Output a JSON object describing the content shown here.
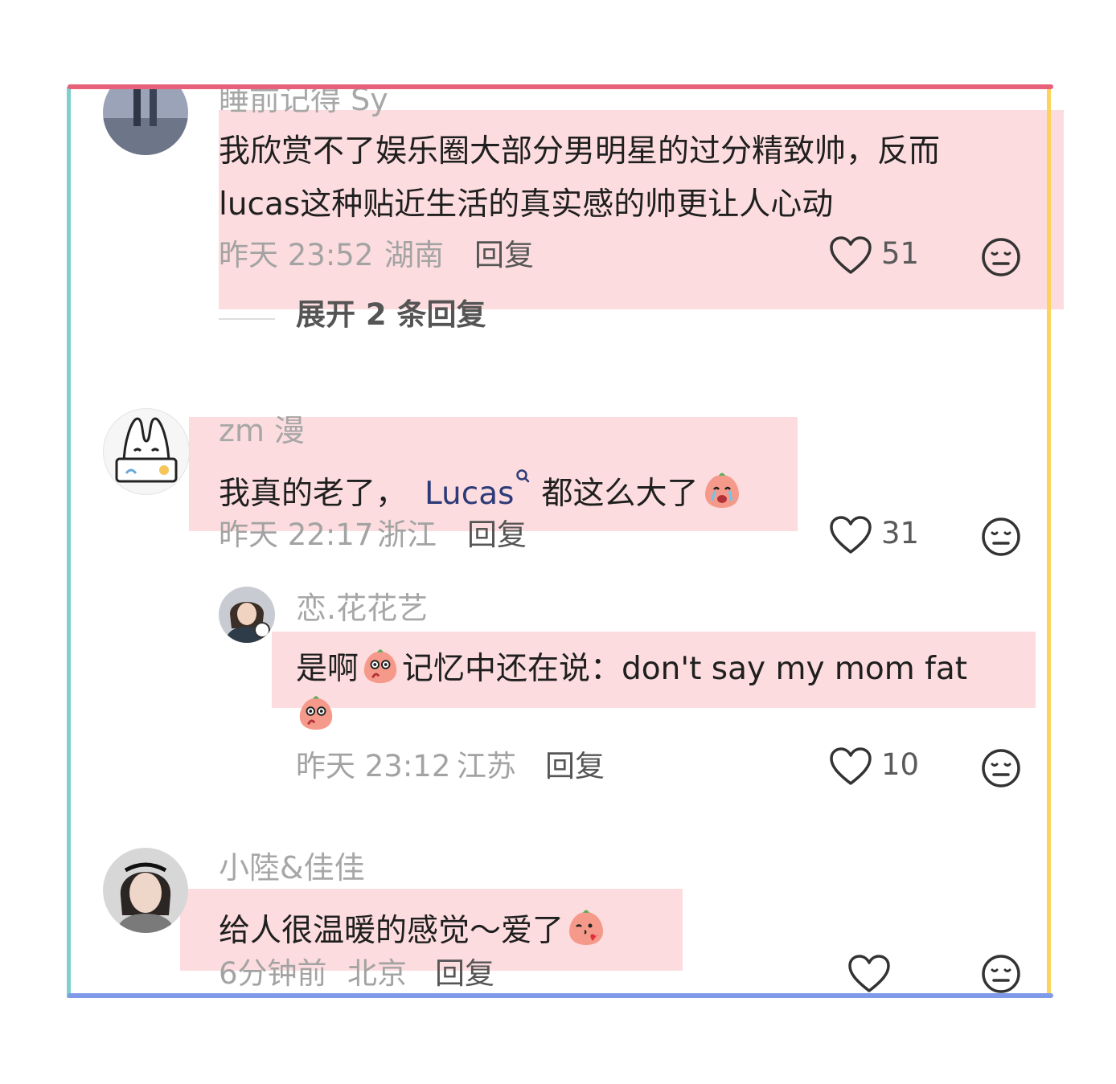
{
  "comments": [
    {
      "username": "睡前记得 Sy",
      "text_line1": "我欣赏不了娱乐圈大部分男明星的过分精致帅，反而",
      "text_line2": "lucas这种贴近生活的真实感的帅更让人心动",
      "time": "昨天 23:52",
      "location": "湖南",
      "reply_label": "回复",
      "likes": "51",
      "expand_label": "展开 2 条回复"
    },
    {
      "username": "zm 漫",
      "text_prefix": "我真的老了，",
      "link_text": "Lucas",
      "text_suffix": "都这么大了",
      "time": "昨天 22:17",
      "location": "浙江",
      "reply_label": "回复",
      "likes": "31",
      "reply": {
        "username": "恋.花花艺",
        "text_prefix": "是啊",
        "text_suffix": "记忆中还在说：don't  say  my mom fat",
        "time": "昨天 23:12",
        "location": "江苏",
        "reply_label": "回复",
        "likes": "10"
      }
    },
    {
      "username": "小陸&佳佳",
      "text": "给人很温暖的感觉～爱了",
      "time": "6分钟前",
      "location": "北京",
      "reply_label": "回复",
      "likes": ""
    }
  ],
  "icons": {
    "like": "heart-outline-icon",
    "dislike": "meh-face-icon",
    "emoji": "peach-face-emoji"
  },
  "colors": {
    "highlight": "#f8a8b0",
    "frame_top": "#e8617a",
    "frame_left": "#7fcfcf",
    "frame_right": "#fdd35c",
    "frame_bottom": "#7f9ae8",
    "mention": "#2d3a78"
  }
}
